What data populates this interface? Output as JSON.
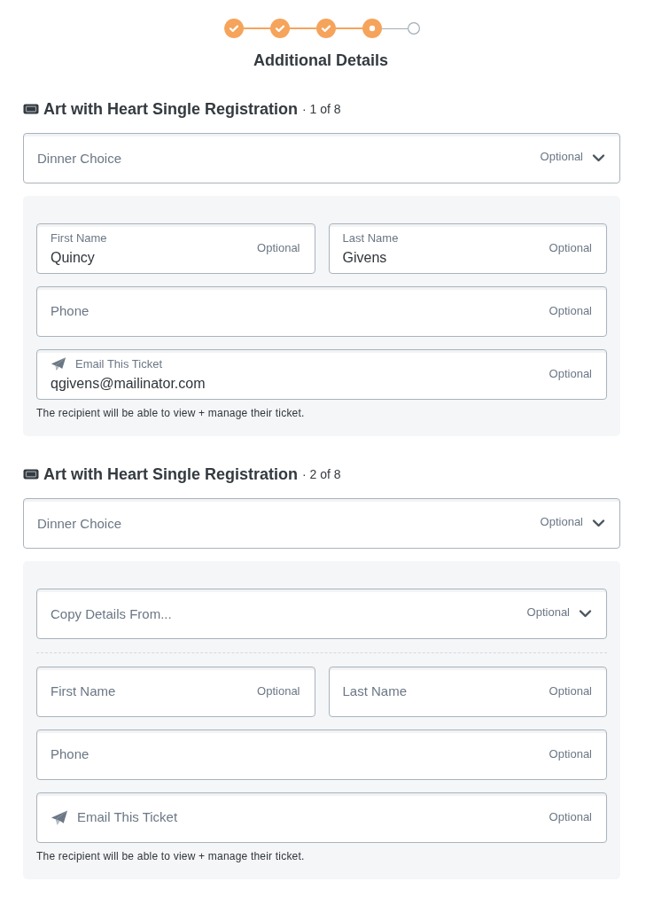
{
  "stepper": {
    "steps": [
      {
        "kind": "done"
      },
      {
        "kind": "done"
      },
      {
        "kind": "done"
      },
      {
        "kind": "current"
      },
      {
        "kind": "upcoming"
      }
    ]
  },
  "title": "Additional Details",
  "tickets": [
    {
      "name": "Art with Heart Single Registration",
      "position": "· 1 of 8",
      "dinner_choice": {
        "kind": "select",
        "label": "Dinner Choice",
        "hint": "Optional"
      },
      "attendee": {
        "rows": [
          [
            {
              "kind": "text",
              "label": "First Name",
              "value": "Quincy",
              "hint": "Optional"
            },
            {
              "kind": "text",
              "label": "Last Name",
              "value": "Givens",
              "hint": "Optional"
            }
          ],
          [
            {
              "kind": "text",
              "label": "Phone",
              "hint": "Optional"
            }
          ],
          [
            {
              "kind": "email",
              "label": "Email This Ticket",
              "value": "qgivens@mailinator.com",
              "hint": "Optional"
            }
          ]
        ],
        "note": "The recipient will be able to view + manage their ticket."
      }
    },
    {
      "name": "Art with Heart Single Registration",
      "position": "· 2 of 8",
      "dinner_choice": {
        "kind": "select",
        "label": "Dinner Choice",
        "hint": "Optional"
      },
      "attendee": {
        "rows": [
          [
            {
              "kind": "select",
              "label": "Copy Details From...",
              "hint": "Optional"
            }
          ],
          [
            {
              "kind": "divider"
            }
          ],
          [
            {
              "kind": "text",
              "label": "First Name",
              "hint": "Optional"
            },
            {
              "kind": "text",
              "label": "Last Name",
              "hint": "Optional"
            }
          ],
          [
            {
              "kind": "text",
              "label": "Phone",
              "hint": "Optional"
            }
          ],
          [
            {
              "kind": "email",
              "label": "Email This Ticket",
              "hint": "Optional"
            }
          ]
        ],
        "note": "The recipient will be able to view + manage their ticket."
      }
    }
  ]
}
